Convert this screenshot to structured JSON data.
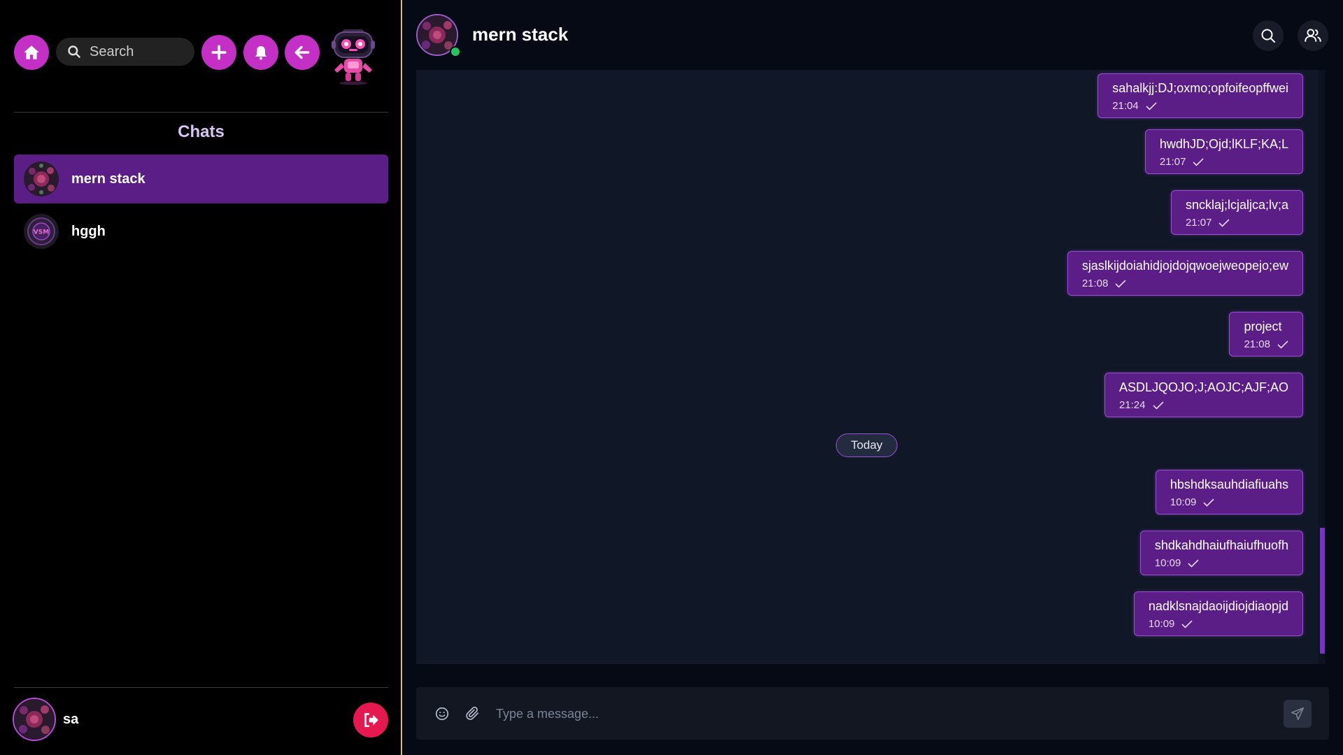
{
  "sidebar": {
    "search": {
      "placeholder": "Search",
      "value": ""
    },
    "chats_title": "Chats",
    "chats": [
      {
        "name": "mern stack",
        "active": true,
        "avatar": "floral-avatar"
      },
      {
        "name": "hggh",
        "active": false,
        "avatar": "vsm-badge-avatar"
      }
    ],
    "current_user": {
      "name": "sa"
    }
  },
  "chat": {
    "title": "mern stack",
    "online": true,
    "messages": [
      {
        "text": "sahalkjj:DJ;oxmo;opfoifeopffwei",
        "time": "21:04",
        "status": "sent"
      },
      {
        "text": "hwdhJD;Ojd;lKLF;KA;L",
        "time": "21:07",
        "status": "sent"
      },
      {
        "text": "sncklaj;lcjaljca;lv;a",
        "time": "21:07",
        "status": "sent"
      },
      {
        "text": "sjaslkijdoiahidjojdojqwoejweopejo;ew",
        "time": "21:08",
        "status": "sent"
      },
      {
        "text": "project",
        "time": "21:08",
        "status": "sent"
      },
      {
        "text": "ASDLJQOJO;J;AOJC;AJF;AO",
        "time": "21:24",
        "status": "sent"
      },
      {
        "text": "hbshdksauhdiafiuahs",
        "time": "10:09",
        "status": "sent"
      },
      {
        "text": "shdkahdhaiufhaiufhuofh",
        "time": "10:09",
        "status": "sent"
      },
      {
        "text": "nadklsnajdaoijdiojdiaopjd",
        "time": "10:09",
        "status": "sent"
      }
    ],
    "date_separator": "Today",
    "input": {
      "placeholder": "Type a message...",
      "value": ""
    }
  },
  "colors": {
    "accent": "#c430c6",
    "bubble": "#5b1d86",
    "bubble_border": "#9b4ed8",
    "logout": "#e5194f",
    "online": "#22c55e"
  },
  "icons": [
    "home-icon",
    "search-icon",
    "plus-icon",
    "bell-icon",
    "arrow-left-icon",
    "robot-mascot",
    "search-icon",
    "users-icon",
    "emoji-icon",
    "paperclip-icon",
    "send-icon",
    "logout-icon",
    "check-icon"
  ]
}
